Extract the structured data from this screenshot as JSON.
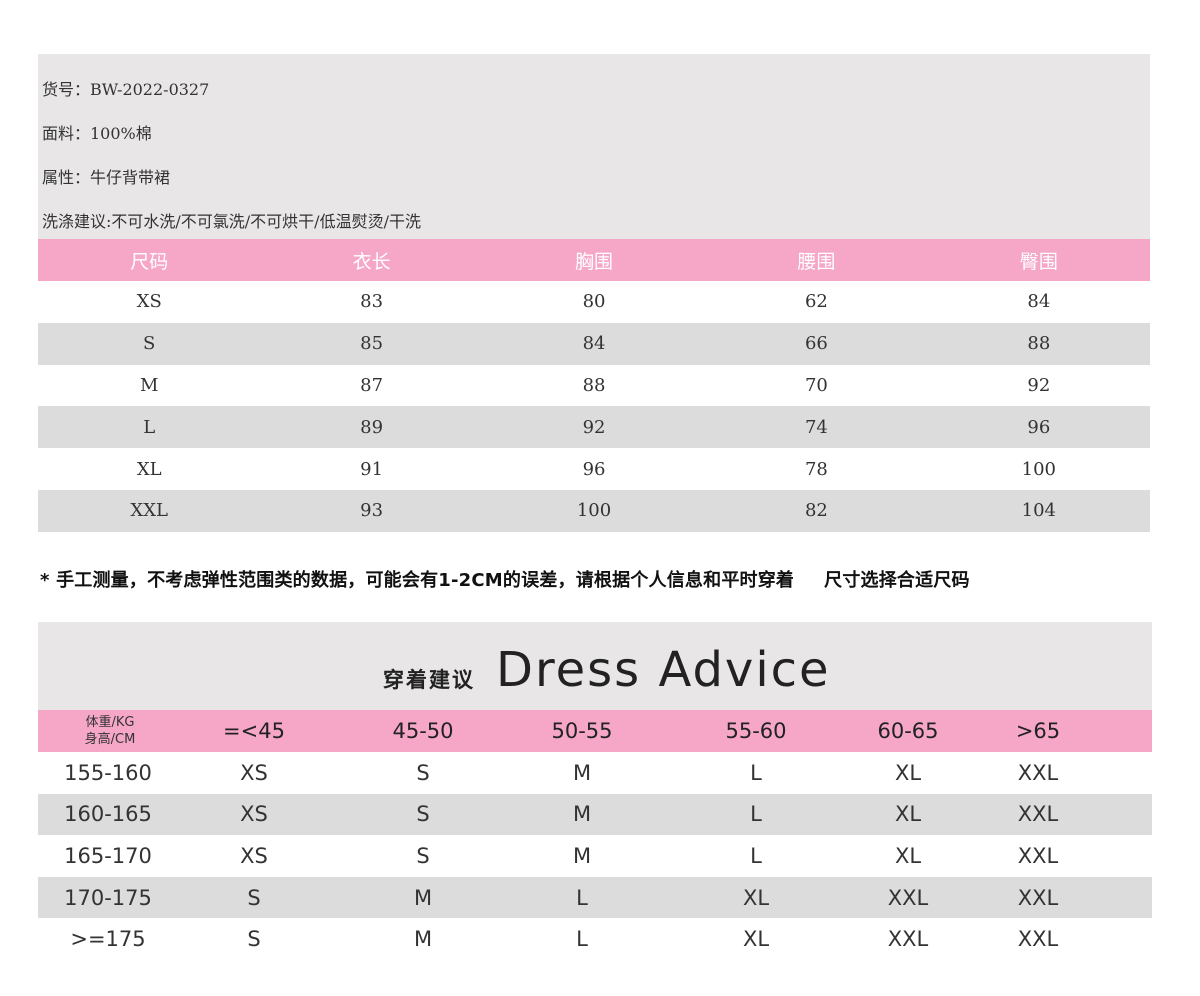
{
  "product": {
    "item_no": "货号：BW-2022-0327",
    "fabric": "面料：100%棉",
    "attribute": "属性：牛仔背带裙",
    "washing": "洗涤建议:不可水洗/不可氯洗/不可烘干/低温熨烫/干洗"
  },
  "size_table": {
    "headers": [
      "尺码",
      "衣长",
      "胸围",
      "腰围",
      "臀围"
    ],
    "rows": [
      [
        "XS",
        "83",
        "80",
        "62",
        "84"
      ],
      [
        "S",
        "85",
        "84",
        "66",
        "88"
      ],
      [
        "M",
        "87",
        "88",
        "70",
        "92"
      ],
      [
        "L",
        "89",
        "92",
        "74",
        "96"
      ],
      [
        "XL",
        "91",
        "96",
        "78",
        "100"
      ],
      [
        "XXL",
        "93",
        "100",
        "82",
        "104"
      ]
    ]
  },
  "note": {
    "part1": "* 手工测量，不考虑弹性范围类的数据，可能会有1-2CM的误差，请根据个人信息和平时穿着",
    "part2": "尺寸选择合适尺码"
  },
  "advice": {
    "title_cn": "穿着建议",
    "title_en": "Dress Advice",
    "corner_top": "体重/KG",
    "corner_bottom": "身高/CM",
    "weights": [
      "=<45",
      "45-50",
      "50-55",
      "55-60",
      "60-65",
      ">65"
    ],
    "rows": [
      {
        "height": "155-160",
        "sizes": [
          "XS",
          "S",
          "M",
          "L",
          "XL",
          "XXL"
        ]
      },
      {
        "height": "160-165",
        "sizes": [
          "XS",
          "S",
          "M",
          "L",
          "XL",
          "XXL"
        ]
      },
      {
        "height": "165-170",
        "sizes": [
          "XS",
          "S",
          "M",
          "L",
          "XL",
          "XXL"
        ]
      },
      {
        "height": "170-175",
        "sizes": [
          "S",
          "M",
          "L",
          "XL",
          "XXL",
          "XXL"
        ]
      },
      {
        "height": ">=175",
        "sizes": [
          "S",
          "M",
          "L",
          "XL",
          "XXL",
          "XXL"
        ]
      }
    ]
  },
  "colors": {
    "header_pink": "#f6a7c8",
    "panel_gray": "#e8e6e7",
    "stripe_gray": "#dcdcdc"
  }
}
